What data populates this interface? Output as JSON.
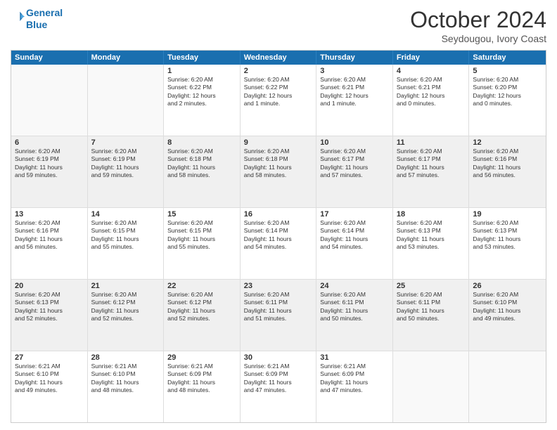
{
  "logo": {
    "line1": "General",
    "line2": "Blue"
  },
  "title": "October 2024",
  "subtitle": "Seydougou, Ivory Coast",
  "header": {
    "days": [
      "Sunday",
      "Monday",
      "Tuesday",
      "Wednesday",
      "Thursday",
      "Friday",
      "Saturday"
    ]
  },
  "rows": [
    [
      {
        "day": "",
        "empty": true,
        "text": ""
      },
      {
        "day": "",
        "empty": true,
        "text": ""
      },
      {
        "day": "1",
        "text": "Sunrise: 6:20 AM\nSunset: 6:22 PM\nDaylight: 12 hours\nand 2 minutes."
      },
      {
        "day": "2",
        "text": "Sunrise: 6:20 AM\nSunset: 6:22 PM\nDaylight: 12 hours\nand 1 minute."
      },
      {
        "day": "3",
        "text": "Sunrise: 6:20 AM\nSunset: 6:21 PM\nDaylight: 12 hours\nand 1 minute."
      },
      {
        "day": "4",
        "text": "Sunrise: 6:20 AM\nSunset: 6:21 PM\nDaylight: 12 hours\nand 0 minutes."
      },
      {
        "day": "5",
        "text": "Sunrise: 6:20 AM\nSunset: 6:20 PM\nDaylight: 12 hours\nand 0 minutes."
      }
    ],
    [
      {
        "day": "6",
        "text": "Sunrise: 6:20 AM\nSunset: 6:19 PM\nDaylight: 11 hours\nand 59 minutes."
      },
      {
        "day": "7",
        "text": "Sunrise: 6:20 AM\nSunset: 6:19 PM\nDaylight: 11 hours\nand 59 minutes."
      },
      {
        "day": "8",
        "text": "Sunrise: 6:20 AM\nSunset: 6:18 PM\nDaylight: 11 hours\nand 58 minutes."
      },
      {
        "day": "9",
        "text": "Sunrise: 6:20 AM\nSunset: 6:18 PM\nDaylight: 11 hours\nand 58 minutes."
      },
      {
        "day": "10",
        "text": "Sunrise: 6:20 AM\nSunset: 6:17 PM\nDaylight: 11 hours\nand 57 minutes."
      },
      {
        "day": "11",
        "text": "Sunrise: 6:20 AM\nSunset: 6:17 PM\nDaylight: 11 hours\nand 57 minutes."
      },
      {
        "day": "12",
        "text": "Sunrise: 6:20 AM\nSunset: 6:16 PM\nDaylight: 11 hours\nand 56 minutes."
      }
    ],
    [
      {
        "day": "13",
        "text": "Sunrise: 6:20 AM\nSunset: 6:16 PM\nDaylight: 11 hours\nand 56 minutes."
      },
      {
        "day": "14",
        "text": "Sunrise: 6:20 AM\nSunset: 6:15 PM\nDaylight: 11 hours\nand 55 minutes."
      },
      {
        "day": "15",
        "text": "Sunrise: 6:20 AM\nSunset: 6:15 PM\nDaylight: 11 hours\nand 55 minutes."
      },
      {
        "day": "16",
        "text": "Sunrise: 6:20 AM\nSunset: 6:14 PM\nDaylight: 11 hours\nand 54 minutes."
      },
      {
        "day": "17",
        "text": "Sunrise: 6:20 AM\nSunset: 6:14 PM\nDaylight: 11 hours\nand 54 minutes."
      },
      {
        "day": "18",
        "text": "Sunrise: 6:20 AM\nSunset: 6:13 PM\nDaylight: 11 hours\nand 53 minutes."
      },
      {
        "day": "19",
        "text": "Sunrise: 6:20 AM\nSunset: 6:13 PM\nDaylight: 11 hours\nand 53 minutes."
      }
    ],
    [
      {
        "day": "20",
        "text": "Sunrise: 6:20 AM\nSunset: 6:13 PM\nDaylight: 11 hours\nand 52 minutes."
      },
      {
        "day": "21",
        "text": "Sunrise: 6:20 AM\nSunset: 6:12 PM\nDaylight: 11 hours\nand 52 minutes."
      },
      {
        "day": "22",
        "text": "Sunrise: 6:20 AM\nSunset: 6:12 PM\nDaylight: 11 hours\nand 52 minutes."
      },
      {
        "day": "23",
        "text": "Sunrise: 6:20 AM\nSunset: 6:11 PM\nDaylight: 11 hours\nand 51 minutes."
      },
      {
        "day": "24",
        "text": "Sunrise: 6:20 AM\nSunset: 6:11 PM\nDaylight: 11 hours\nand 50 minutes."
      },
      {
        "day": "25",
        "text": "Sunrise: 6:20 AM\nSunset: 6:11 PM\nDaylight: 11 hours\nand 50 minutes."
      },
      {
        "day": "26",
        "text": "Sunrise: 6:20 AM\nSunset: 6:10 PM\nDaylight: 11 hours\nand 49 minutes."
      }
    ],
    [
      {
        "day": "27",
        "text": "Sunrise: 6:21 AM\nSunset: 6:10 PM\nDaylight: 11 hours\nand 49 minutes."
      },
      {
        "day": "28",
        "text": "Sunrise: 6:21 AM\nSunset: 6:10 PM\nDaylight: 11 hours\nand 48 minutes."
      },
      {
        "day": "29",
        "text": "Sunrise: 6:21 AM\nSunset: 6:09 PM\nDaylight: 11 hours\nand 48 minutes."
      },
      {
        "day": "30",
        "text": "Sunrise: 6:21 AM\nSunset: 6:09 PM\nDaylight: 11 hours\nand 47 minutes."
      },
      {
        "day": "31",
        "text": "Sunrise: 6:21 AM\nSunset: 6:09 PM\nDaylight: 11 hours\nand 47 minutes."
      },
      {
        "day": "",
        "empty": true,
        "text": ""
      },
      {
        "day": "",
        "empty": true,
        "text": ""
      }
    ]
  ]
}
